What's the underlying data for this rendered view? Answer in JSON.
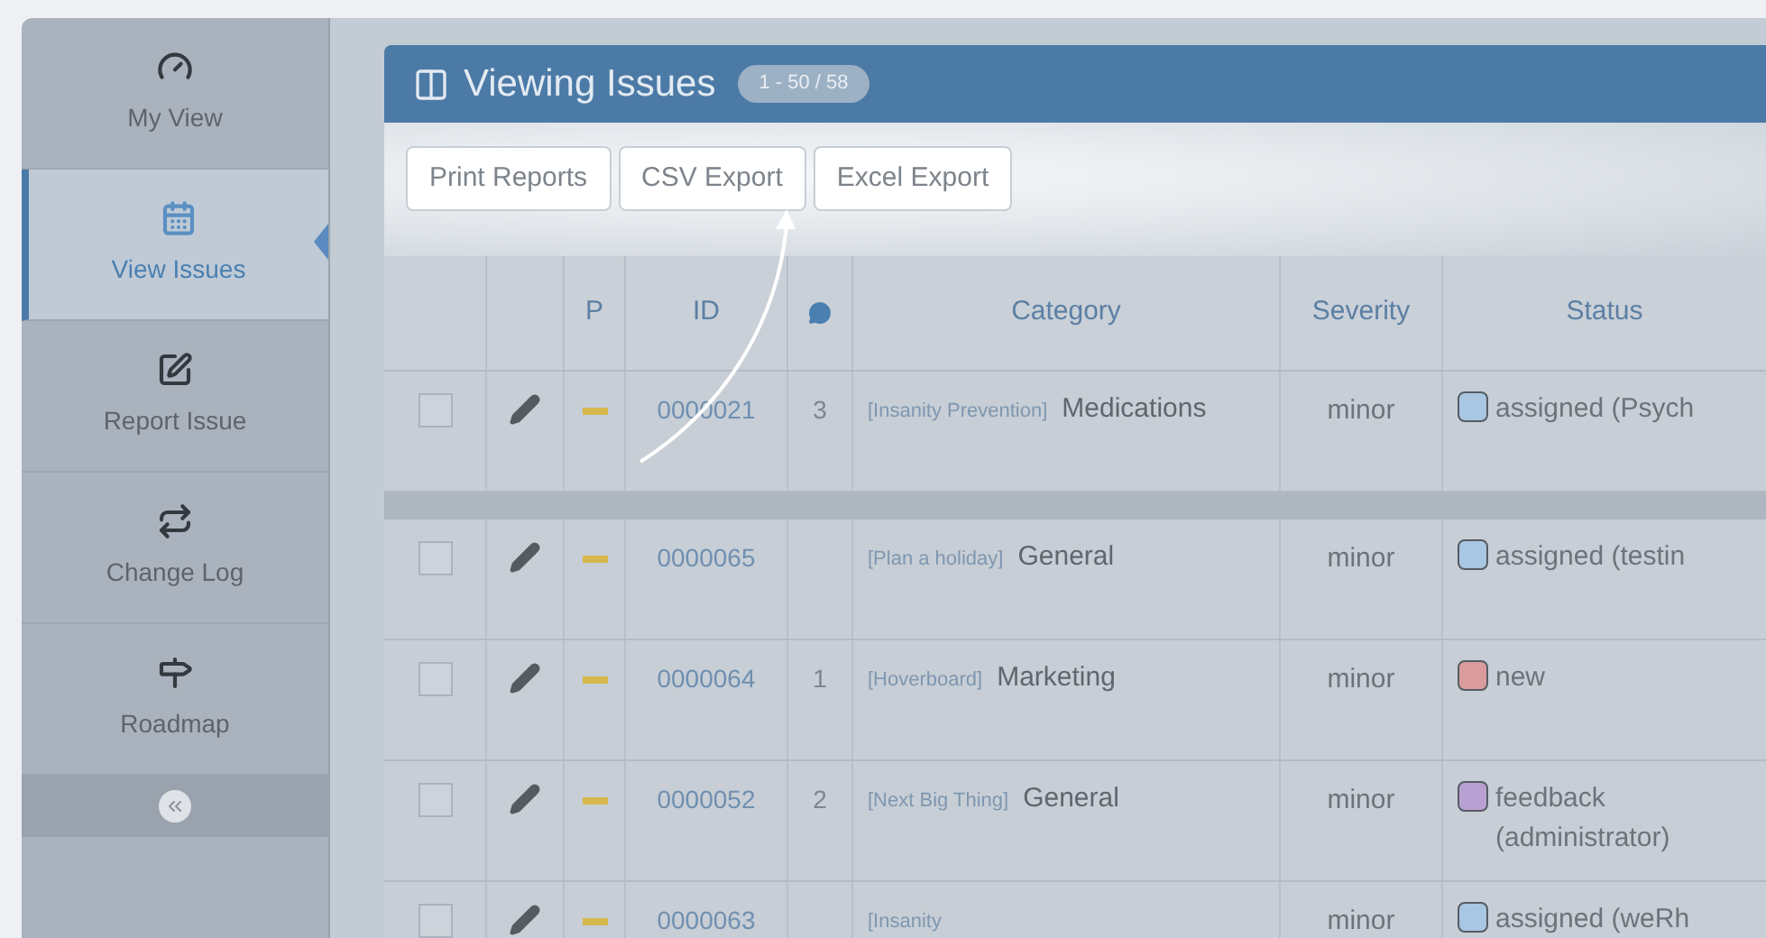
{
  "sidebar": {
    "items": [
      {
        "label": "My View",
        "selected": false
      },
      {
        "label": "View Issues",
        "selected": true
      },
      {
        "label": "Report Issue",
        "selected": false
      },
      {
        "label": "Change Log",
        "selected": false
      },
      {
        "label": "Roadmap",
        "selected": false
      }
    ]
  },
  "panel": {
    "title": "Viewing Issues",
    "count": "1 - 50 / 58"
  },
  "toolbar": {
    "buttons": [
      "Print Reports",
      "CSV Export",
      "Excel Export"
    ]
  },
  "table": {
    "columns": [
      "P",
      "ID",
      "Category",
      "Severity",
      "Status"
    ],
    "rows": [
      {
        "id": "0000021",
        "notes": "3",
        "project": "[Insanity Prevention]",
        "category": "Medications",
        "severity": "minor",
        "status": "assigned (Psych",
        "color": "#a9c6e2",
        "checked": false
      },
      {
        "id": "0000065",
        "notes": "",
        "project": "[Plan a holiday]",
        "category": "General",
        "severity": "minor",
        "status": "assigned (testin",
        "color": "#a9c6e2",
        "checked": false
      },
      {
        "id": "0000064",
        "notes": "1",
        "project": "[Hoverboard]",
        "category": "Marketing",
        "severity": "minor",
        "status": "new",
        "color": "#d99b9b",
        "checked": false
      },
      {
        "id": "0000052",
        "notes": "2",
        "project": "[Next Big Thing]",
        "category": "General",
        "severity": "minor",
        "status": "feedback (administrator)",
        "color": "#b9a0d2",
        "checked": false
      },
      {
        "id": "0000063",
        "notes": "",
        "project": "[Insanity",
        "category": "",
        "severity": "minor",
        "status": "assigned (weRh",
        "color": "#a9c6e2",
        "checked": false
      }
    ]
  }
}
